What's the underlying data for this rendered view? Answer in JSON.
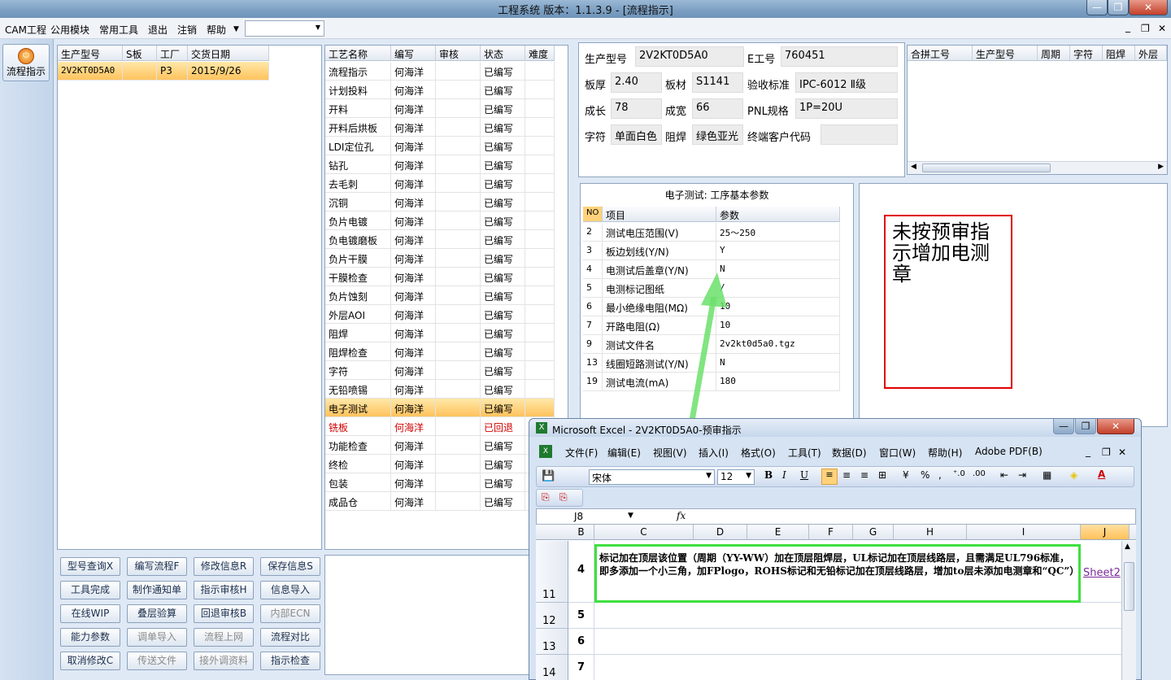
{
  "window": {
    "title": "工程系统   版本：1.1.3.9 - [流程指示]"
  },
  "menu": [
    "CAM工程",
    "公用模块",
    "常用工具",
    "退出",
    "注销",
    "帮助"
  ],
  "leftnav": {
    "button": "流程指示"
  },
  "orders": {
    "headers": [
      "生产型号",
      "S板",
      "工厂",
      "交货日期"
    ],
    "rows": [
      [
        "2V2KT0D5A0",
        "",
        "P3",
        "2015/9/26"
      ]
    ]
  },
  "process": {
    "headers": [
      "工艺名称",
      "编写",
      "审核",
      "状态",
      "难度"
    ],
    "rows": [
      [
        "流程指示",
        "何海洋",
        "",
        "已编写",
        ""
      ],
      [
        "计划投料",
        "何海洋",
        "",
        "已编写",
        ""
      ],
      [
        "开料",
        "何海洋",
        "",
        "已编写",
        ""
      ],
      [
        "开料后烘板",
        "何海洋",
        "",
        "已编写",
        ""
      ],
      [
        "LDI定位孔",
        "何海洋",
        "",
        "已编写",
        ""
      ],
      [
        "钻孔",
        "何海洋",
        "",
        "已编写",
        ""
      ],
      [
        "去毛刺",
        "何海洋",
        "",
        "已编写",
        ""
      ],
      [
        "沉铜",
        "何海洋",
        "",
        "已编写",
        ""
      ],
      [
        "负片电镀",
        "何海洋",
        "",
        "已编写",
        ""
      ],
      [
        "负电镀磨板",
        "何海洋",
        "",
        "已编写",
        ""
      ],
      [
        "负片干膜",
        "何海洋",
        "",
        "已编写",
        ""
      ],
      [
        "干膜检查",
        "何海洋",
        "",
        "已编写",
        ""
      ],
      [
        "负片蚀刻",
        "何海洋",
        "",
        "已编写",
        ""
      ],
      [
        "外层AOI",
        "何海洋",
        "",
        "已编写",
        ""
      ],
      [
        "阻焊",
        "何海洋",
        "",
        "已编写",
        ""
      ],
      [
        "阻焊检查",
        "何海洋",
        "",
        "已编写",
        ""
      ],
      [
        "字符",
        "何海洋",
        "",
        "已编写",
        ""
      ],
      [
        "无铅喷锡",
        "何海洋",
        "",
        "已编写",
        ""
      ],
      [
        "电子测试",
        "何海洋",
        "",
        "已编写",
        ""
      ],
      [
        "铣板",
        "何海洋",
        "",
        "已回退",
        ""
      ],
      [
        "功能检查",
        "何海洋",
        "",
        "已编写",
        ""
      ],
      [
        "终检",
        "何海洋",
        "",
        "已编写",
        ""
      ],
      [
        "包装",
        "何海洋",
        "",
        "已编写",
        ""
      ],
      [
        "成品仓",
        "何海洋",
        "",
        "已编写",
        ""
      ]
    ]
  },
  "buttons": [
    [
      "型号查询X",
      "编写流程F",
      "修改信息R",
      "保存信息S"
    ],
    [
      "工具完成",
      "制作通知单",
      "指示审核H",
      "信息导入"
    ],
    [
      "在线WIP",
      "叠层验算",
      "回退审核B",
      "内部ECN"
    ],
    [
      "能力参数",
      "调单导入",
      "流程上网",
      "流程对比"
    ],
    [
      "取消修改C",
      "传送文件",
      "接外调资料",
      "指示检查"
    ]
  ],
  "info": {
    "model_label": "生产型号",
    "model": "2V2KT0D5A0",
    "e_label": "E工号",
    "e": "760451",
    "thick_label": "板厚",
    "thick": "2.40",
    "mat_label": "板材",
    "mat": "S1141",
    "std_label": "验收标准",
    "std": "IPC-6012 Ⅱ级",
    "len_label": "成长",
    "len": "78",
    "wid_label": "成宽",
    "wid": "66",
    "pnl_label": "PNL规格",
    "pnl": "1P=20U",
    "char_label": "字符",
    "char": "单面白色",
    "mask_label": "阻焊",
    "mask": "绿色亚光",
    "cust_label": "终端客户代码",
    "cust": ""
  },
  "merge": {
    "headers": [
      "合拼工号",
      "生产型号",
      "周期",
      "字符",
      "阻焊",
      "外层"
    ]
  },
  "params": {
    "title": "电子测试: 工序基本参数",
    "headers": [
      "NO",
      "项目",
      "参数"
    ],
    "rows": [
      [
        "2",
        "测试电压范围(V)",
        "25～250"
      ],
      [
        "3",
        "板边划线(Y/N)",
        "Y"
      ],
      [
        "4",
        "电测试后盖章(Y/N)",
        "N"
      ],
      [
        "5",
        "电测标记图纸",
        "/"
      ],
      [
        "6",
        "最小绝缘电阻(MΩ)",
        "10"
      ],
      [
        "7",
        "开路电阻(Ω)",
        "10"
      ],
      [
        "9",
        "测试文件名",
        "2v2kt0d5a0.tgz"
      ],
      [
        "13",
        "线圈短路测试(Y/N)",
        "N"
      ],
      [
        "19",
        "测试电流(mA)",
        "180"
      ]
    ]
  },
  "note": "未按预审指示增加电测章",
  "excel": {
    "title": "Microsoft Excel - 2V2KT0D5A0-预审指示",
    "menu": [
      "文件(F)",
      "编辑(E)",
      "视图(V)",
      "插入(I)",
      "格式(O)",
      "工具(T)",
      "数据(D)",
      "窗口(W)",
      "帮助(H)",
      "Adobe PDF(B)"
    ],
    "font": "宋体",
    "size": "12",
    "cellref": "J8",
    "fx": "fx",
    "columns": [
      "B",
      "C",
      "D",
      "E",
      "F",
      "G",
      "H",
      "I",
      "J"
    ],
    "rows": [
      "11",
      "12",
      "13",
      "14"
    ],
    "bvals": [
      "4",
      "5",
      "6",
      "7"
    ],
    "cell_text": "标记加在顶层该位置（周期（YY-WW）加在顶层阻焊层，UL标记加在顶层线路层，且需满足UL796标准，即多添加一个小三角，加FPlogo，ROHS标记和无铅标记加在顶层线路层，增加to层未添加电测章和“QC”）",
    "link": "Sheet2"
  }
}
